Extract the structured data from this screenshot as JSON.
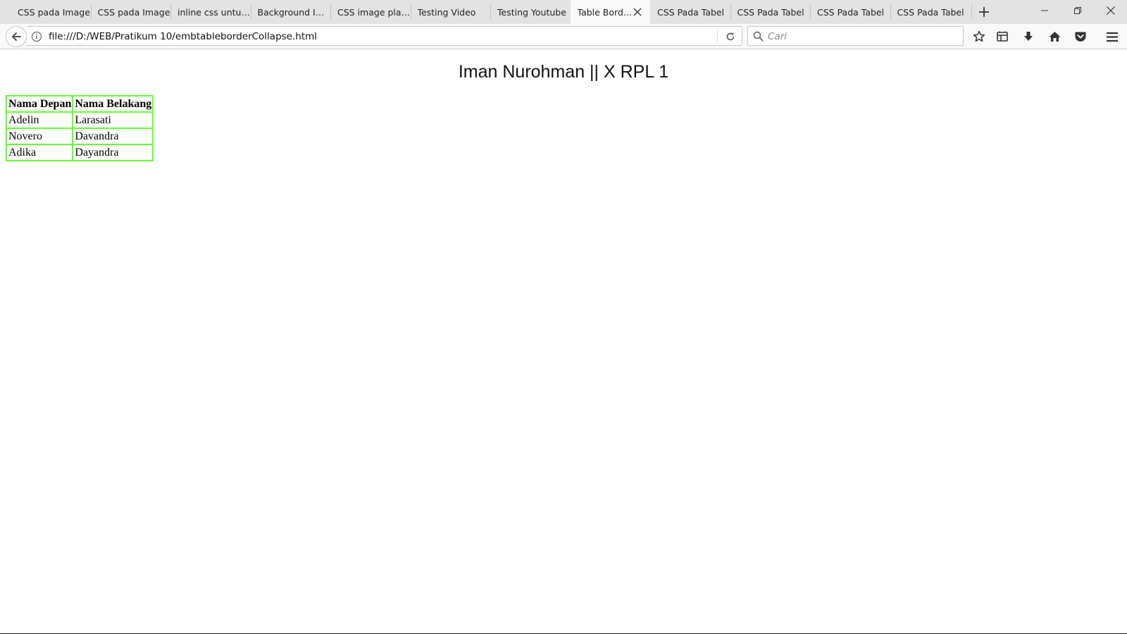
{
  "browser": {
    "tabs": [
      {
        "label": "CSS pada Image",
        "active": false
      },
      {
        "label": "CSS pada Image",
        "active": false
      },
      {
        "label": "inline css untuk ...",
        "active": false
      },
      {
        "label": "Background Im...",
        "active": false
      },
      {
        "label": "CSS image plac...",
        "active": false
      },
      {
        "label": "Testing Video",
        "active": false
      },
      {
        "label": "Testing Youtube",
        "active": false
      },
      {
        "label": "Table Bord...",
        "active": true
      },
      {
        "label": "CSS Pada Tabel",
        "active": false
      },
      {
        "label": "CSS Pada Tabel",
        "active": false
      },
      {
        "label": "CSS Pada Tabel",
        "active": false
      },
      {
        "label": "CSS Pada Tabel",
        "active": false
      }
    ],
    "url": "file:///D:/WEB/Pratikum 10/embtableborderCollapse.html",
    "search_placeholder": "Cari",
    "icons": {
      "back": "back-arrow-icon",
      "info": "info-icon",
      "reload": "reload-icon",
      "search": "search-icon",
      "bookmark": "star-icon",
      "library": "library-icon",
      "download": "download-icon",
      "home": "home-icon",
      "pocket": "pocket-icon",
      "menu": "hamburger-menu-icon"
    }
  },
  "page": {
    "heading": "Iman Nurohman || X RPL 1",
    "table": {
      "border_color": "#66ff33",
      "headers": [
        "Nama Depan",
        "Nama Belakang"
      ],
      "rows": [
        [
          "Adelin",
          "Larasati"
        ],
        [
          "Novero",
          "Davandra"
        ],
        [
          "Adika",
          "Dayandra"
        ]
      ]
    }
  }
}
